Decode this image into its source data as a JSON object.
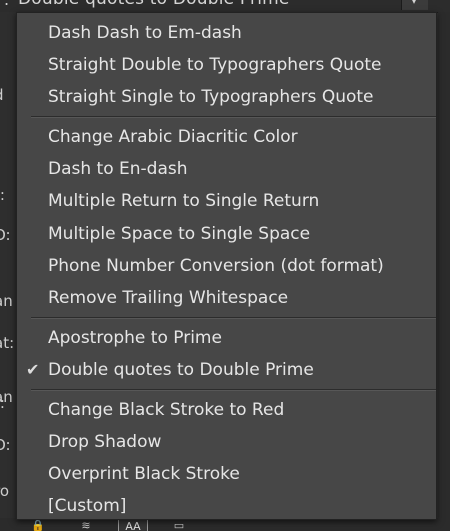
{
  "top_select": {
    "value": "Double quotes to Double Prime",
    "left_char": "."
  },
  "background_labels": [
    "d",
    "t:",
    "O:",
    "an",
    "at:",
    "an",
    "t:",
    "O:",
    "ro"
  ],
  "bottom_toolbar": {
    "aa_label": "AA"
  },
  "menu": {
    "groups": [
      {
        "items": [
          {
            "label": "Dash Dash to Em-dash",
            "checked": false
          },
          {
            "label": "Straight Double to Typographers Quote",
            "checked": false
          },
          {
            "label": "Straight Single to Typographers Quote",
            "checked": false
          }
        ]
      },
      {
        "items": [
          {
            "label": "Change Arabic Diacritic Color",
            "checked": false
          },
          {
            "label": "Dash to En-dash",
            "checked": false
          },
          {
            "label": "Multiple Return to Single Return",
            "checked": false
          },
          {
            "label": "Multiple Space to Single Space",
            "checked": false
          },
          {
            "label": "Phone Number Conversion (dot format)",
            "checked": false
          },
          {
            "label": "Remove Trailing Whitespace",
            "checked": false
          }
        ]
      },
      {
        "items": [
          {
            "label": "Apostrophe to Prime",
            "checked": false
          },
          {
            "label": "Double quotes to Double Prime",
            "checked": true
          }
        ]
      },
      {
        "items": [
          {
            "label": "Change Black Stroke to Red",
            "checked": false
          },
          {
            "label": "Drop Shadow",
            "checked": false
          },
          {
            "label": "Overprint Black Stroke",
            "checked": false
          },
          {
            "label": "[Custom]",
            "checked": false
          }
        ]
      }
    ],
    "check_glyph": "✔"
  },
  "colors": {
    "menu_bg": "#474747",
    "menu_text": "#e6e6e6",
    "panel_bg": "#303030"
  }
}
